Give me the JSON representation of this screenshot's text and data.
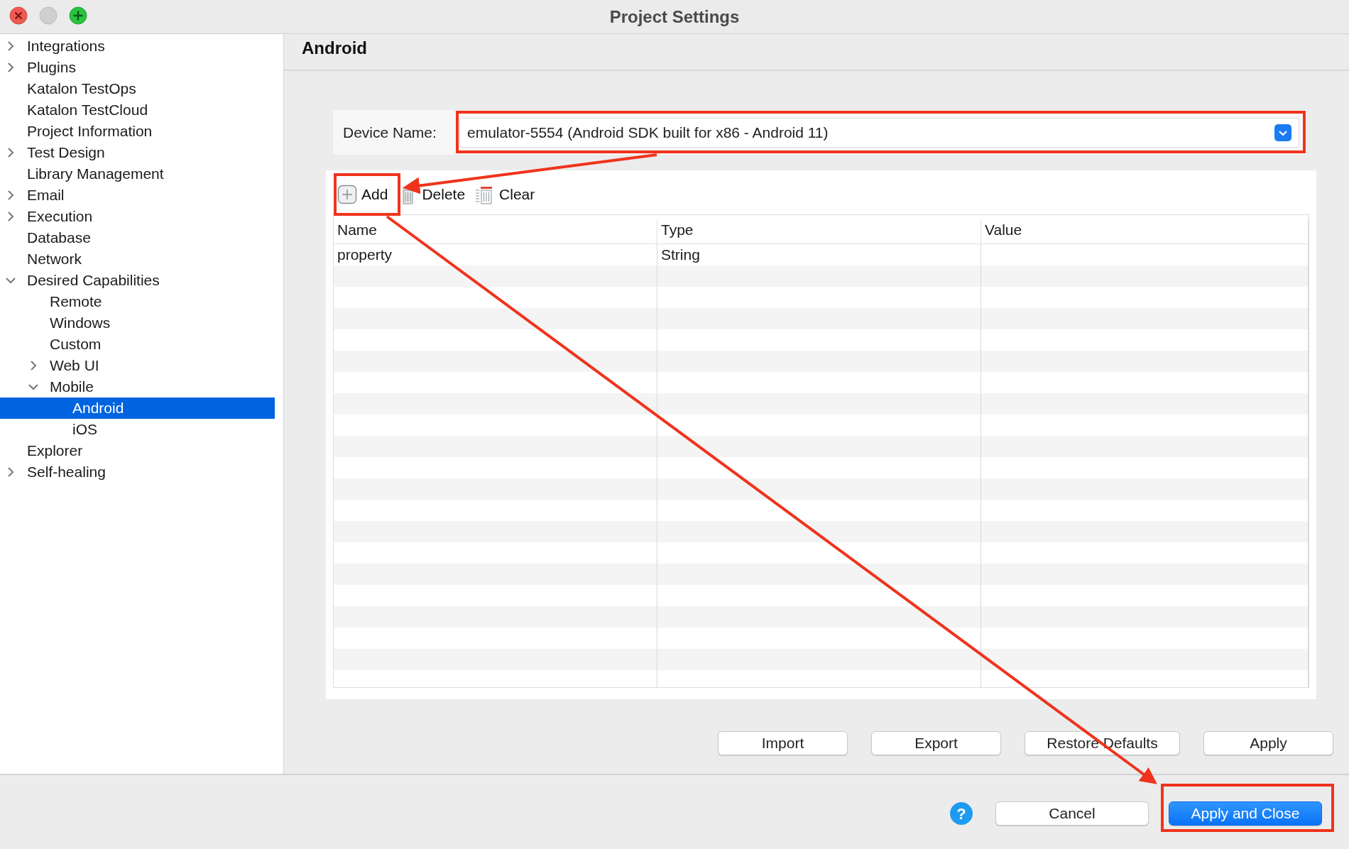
{
  "window": {
    "title": "Project Settings"
  },
  "sidebar": {
    "items": [
      {
        "label": "Integrations",
        "expanded": false,
        "selected": false
      },
      {
        "label": "Plugins",
        "expanded": false,
        "selected": false
      },
      {
        "label": "Katalon TestOps",
        "selected": false
      },
      {
        "label": "Katalon TestCloud",
        "selected": false
      },
      {
        "label": "Project Information",
        "selected": false
      },
      {
        "label": "Test Design",
        "expanded": false,
        "selected": false
      },
      {
        "label": "Library Management",
        "selected": false
      },
      {
        "label": "Email",
        "expanded": false,
        "selected": false
      },
      {
        "label": "Execution",
        "expanded": false,
        "selected": false
      },
      {
        "label": "Database",
        "selected": false
      },
      {
        "label": "Network",
        "selected": false
      },
      {
        "label": "Desired Capabilities",
        "expanded": true,
        "selected": false,
        "children": [
          {
            "label": "Remote",
            "selected": false
          },
          {
            "label": "Windows",
            "selected": false
          },
          {
            "label": "Custom",
            "selected": false
          },
          {
            "label": "Web UI",
            "expanded": false,
            "selected": false
          },
          {
            "label": "Mobile",
            "expanded": true,
            "selected": false,
            "children": [
              {
                "label": "Android",
                "selected": true
              },
              {
                "label": "iOS",
                "selected": false
              }
            ]
          }
        ]
      },
      {
        "label": "Explorer",
        "selected": false
      },
      {
        "label": "Self-healing",
        "expanded": false,
        "selected": false
      }
    ]
  },
  "page": {
    "title": "Android",
    "device": {
      "label": "Device Name:",
      "value": "emulator-5554 (Android SDK built for x86 - Android 11)"
    },
    "toolbar": [
      {
        "kind": "add",
        "label": "Add"
      },
      {
        "kind": "delete",
        "label": "Delete"
      },
      {
        "kind": "clear",
        "label": "Clear"
      }
    ],
    "table": {
      "columns": [
        "Name",
        "Type",
        "Value"
      ],
      "rows": [
        {
          "name": "property",
          "type": "String"
        }
      ]
    },
    "buttons": [
      "Import",
      "Export",
      "Restore Defaults",
      "Apply"
    ]
  },
  "footer": {
    "help": "?",
    "buttons": [
      {
        "label": "Cancel",
        "primary": false
      },
      {
        "label": "Apply and Close",
        "primary": true
      }
    ]
  }
}
